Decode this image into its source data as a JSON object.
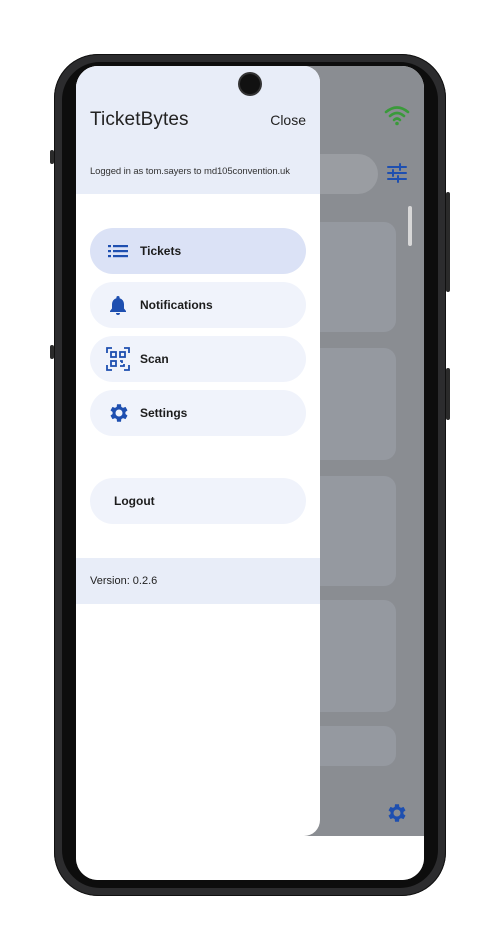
{
  "drawer": {
    "title": "TicketBytes",
    "close_label": "Close",
    "logged_in_text": "Logged in as tom.sayers to md105convention.uk",
    "items": [
      {
        "label": "Tickets",
        "icon": "list-icon",
        "active": true
      },
      {
        "label": "Notifications",
        "icon": "bell-icon",
        "active": false
      },
      {
        "label": "Scan",
        "icon": "qr-scan-icon",
        "active": false
      },
      {
        "label": "Settings",
        "icon": "gear-icon",
        "active": false
      }
    ],
    "logout_label": "Logout",
    "version_text": "Version: 0.2.6"
  },
  "colors": {
    "accent": "#1e4fb0",
    "drawer_header_bg": "#e8edf8",
    "active_item_bg": "#dbe2f6",
    "item_bg": "#f0f3fb",
    "wifi": "#3a9a3a"
  }
}
